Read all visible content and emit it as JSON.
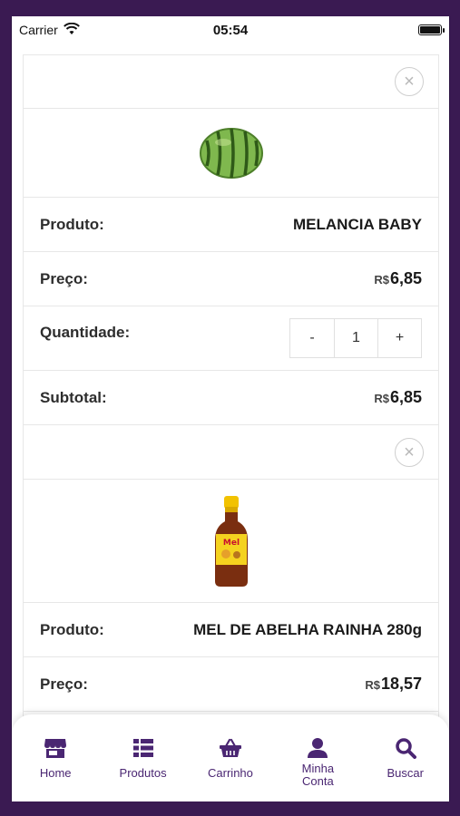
{
  "status_bar": {
    "carrier": "Carrier",
    "time": "05:54"
  },
  "cart_items": [
    {
      "product_label": "Produto:",
      "product_name": "MELANCIA BABY",
      "price_label": "Preço:",
      "currency": "R$",
      "price": "6,85",
      "quantity_label": "Quantidade:",
      "quantity": "1",
      "subtotal_label": "Subtotal:",
      "subtotal": "6,85"
    },
    {
      "product_label": "Produto:",
      "product_name": "MEL DE ABELHA RAINHA 280g",
      "price_label": "Preço:",
      "currency": "R$",
      "price": "18,57"
    }
  ],
  "stepper": {
    "minus": "-",
    "plus": "+"
  },
  "tab_bar": {
    "items": [
      {
        "label": "Home",
        "icon": "store-icon"
      },
      {
        "label": "Produtos",
        "icon": "list-icon"
      },
      {
        "label": "Carrinho",
        "icon": "basket-icon"
      },
      {
        "label_line1": "Minha",
        "label_line2": "Conta",
        "icon": "user-icon"
      },
      {
        "label": "Buscar",
        "icon": "search-icon"
      }
    ]
  },
  "colors": {
    "brand_purple": "#4a2672",
    "background": "#3a1a52"
  }
}
